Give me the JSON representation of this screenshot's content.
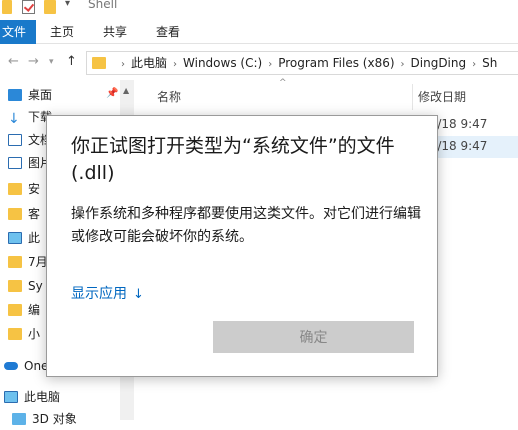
{
  "window": {
    "title": "Shell"
  },
  "ribbon": {
    "tabs": [
      "文件",
      "主页",
      "共享",
      "查看"
    ]
  },
  "address": {
    "breadcrumbs": [
      "此电脑",
      "Windows (C:)",
      "Program Files (x86)",
      "DingDing",
      "Sh"
    ]
  },
  "sidebar": {
    "items": [
      {
        "label": "桌面",
        "icon": "desktop-icon"
      },
      {
        "label": "下载",
        "icon": "download-icon"
      },
      {
        "label": "文档",
        "icon": "document-icon"
      },
      {
        "label": "图片",
        "icon": "picture-icon"
      },
      {
        "label": "安",
        "icon": "folder-icon"
      },
      {
        "label": "客",
        "icon": "folder-icon"
      },
      {
        "label": "此",
        "icon": "computer-icon"
      },
      {
        "label": "7月",
        "icon": "folder-icon"
      },
      {
        "label": "Sy",
        "icon": "folder-icon"
      },
      {
        "label": "编",
        "icon": "folder-icon"
      },
      {
        "label": "小",
        "icon": "folder-icon"
      },
      {
        "label": "One",
        "icon": "onedrive-icon"
      },
      {
        "label": "此电脑",
        "icon": "computer-icon"
      },
      {
        "label": "3D 对象",
        "icon": "3d-objects-icon"
      }
    ]
  },
  "filelist": {
    "columns": {
      "name": "名称",
      "date": "修改日期"
    },
    "rows": [
      {
        "date": "9/7/18 9:47"
      },
      {
        "date": "9/7/18 9:47"
      }
    ]
  },
  "dialog": {
    "title": "你正试图打开类型为“系统文件”的文件(.dll)",
    "message": "操作系统和多种程序都要使用这类文件。对它们进行编辑或修改可能会破坏你的系统。",
    "show_apps_link": "显示应用",
    "ok_button": "确定"
  },
  "colors": {
    "accent": "#1979ca",
    "link": "#0067c0",
    "selection": "#e5f1fb",
    "disabled_button": "#cccccc"
  }
}
